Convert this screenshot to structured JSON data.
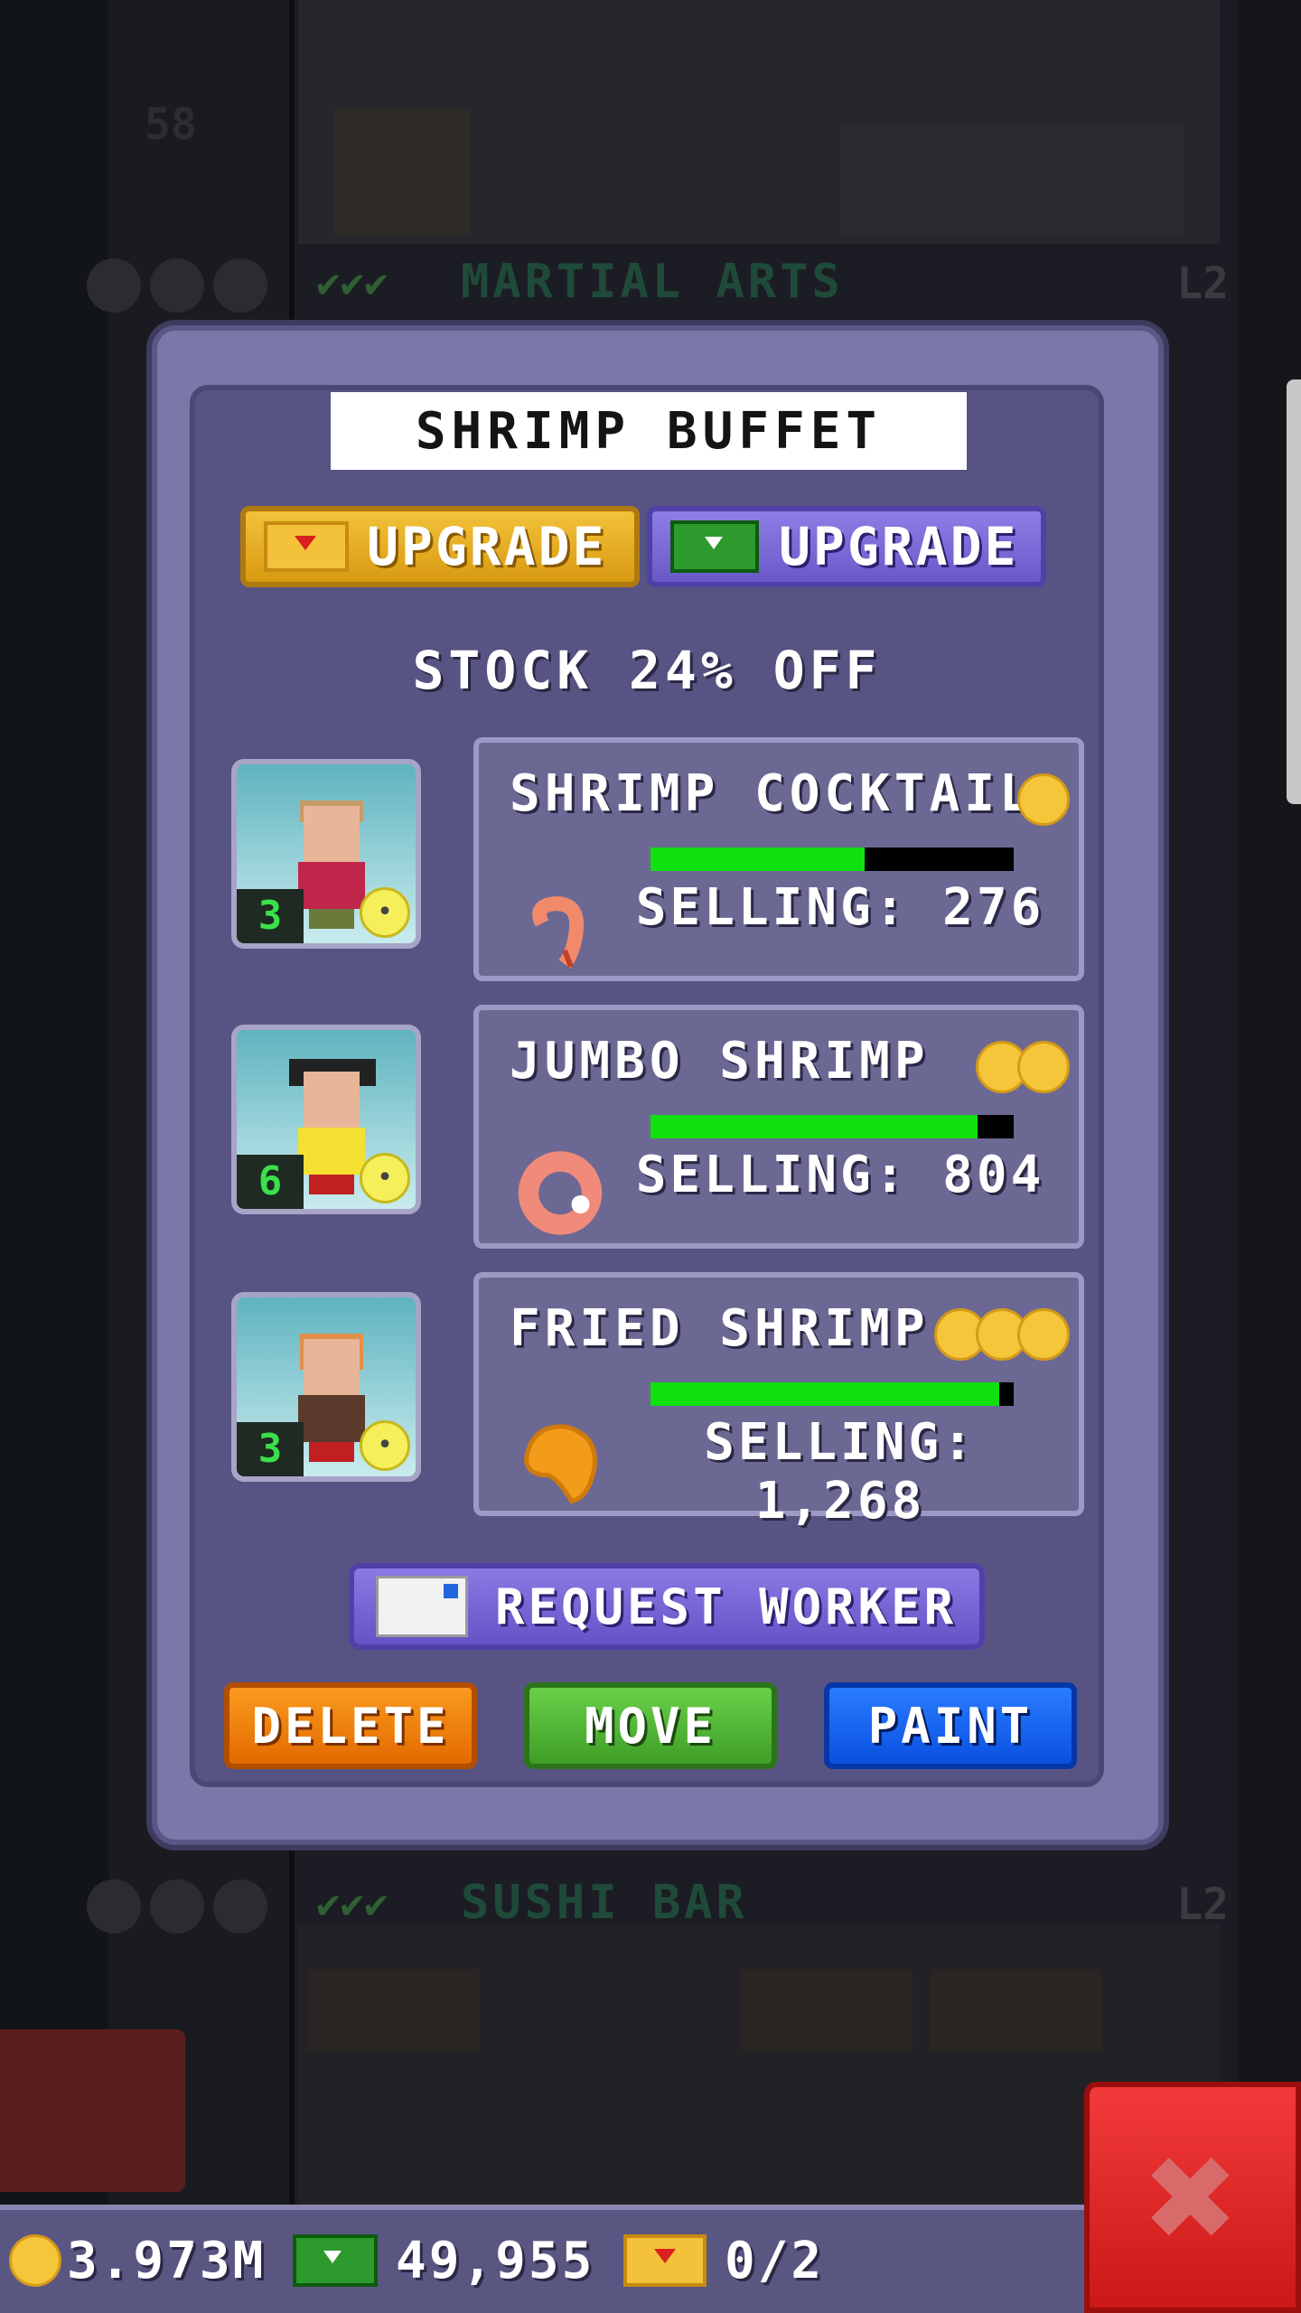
{
  "background": {
    "floors": [
      {
        "name": "MARTIAL ARTS",
        "checks": "✔✔✔",
        "level": "L2"
      },
      {
        "name": "SUSHI BAR",
        "checks": "✔✔✔",
        "level": "L2"
      }
    ],
    "floor_number": "58"
  },
  "dialog": {
    "title": "SHRIMP BUFFET",
    "upgrade_gold_label": "UPGRADE",
    "upgrade_cash_label": "UPGRADE",
    "stock_text": "STOCK 24% OFF",
    "products": [
      {
        "worker_level": "3",
        "name": "SHRIMP COCKTAIL",
        "coins": 1,
        "selling": "SELLING: 276",
        "stock_fraction": 0.59
      },
      {
        "worker_level": "6",
        "name": "JUMBO SHRIMP",
        "coins": 2,
        "selling": "SELLING: 804",
        "stock_fraction": 0.9
      },
      {
        "worker_level": "3",
        "name": "FRIED SHRIMP",
        "coins": 3,
        "selling": "SELLING: 1,268",
        "stock_fraction": 0.96
      }
    ],
    "request_worker_label": "REQUEST WORKER",
    "delete_label": "DELETE",
    "move_label": "MOVE",
    "paint_label": "PAINT"
  },
  "status_bar": {
    "coins": "3.973M",
    "bux": "49,955",
    "tickets": "0/2"
  },
  "colors": {
    "stock_bar": "#10e010",
    "gold_button": "#f2c23a",
    "cash_button": "#8e7ee6",
    "delete": "#fa9a1e",
    "move": "#6ad04a",
    "paint": "#2a7cff",
    "close": "#f23a3a"
  }
}
